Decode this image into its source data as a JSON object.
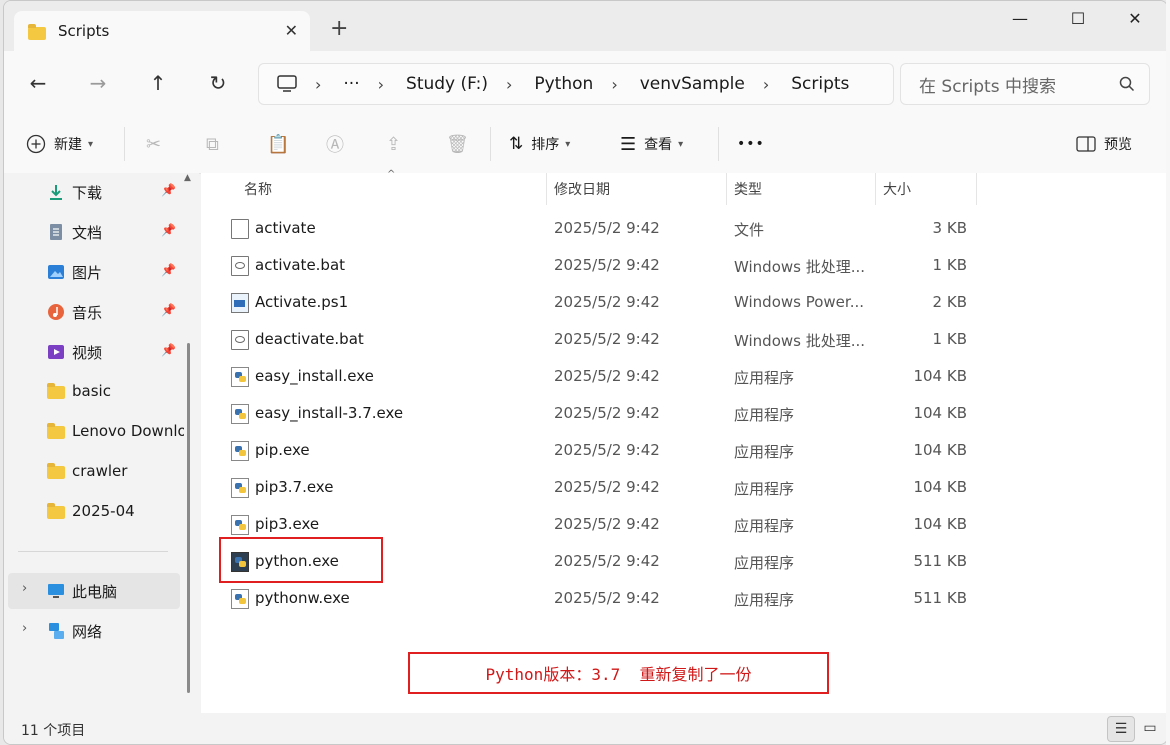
{
  "tab": {
    "title": "Scripts",
    "close": "✕",
    "new": "+"
  },
  "window_controls": {
    "minimize": "—",
    "maximize": "☐",
    "close": "✕"
  },
  "nav": {
    "back": "←",
    "forward": "→",
    "up": "↑",
    "refresh": "↻",
    "breadcrumb": [
      "Study (F:)",
      "Python",
      "venvSample",
      "Scripts"
    ],
    "overflow": "···",
    "separator": "›"
  },
  "search": {
    "placeholder": "在 Scripts 中搜索"
  },
  "toolbar": {
    "new_label": "新建",
    "sort_label": "排序",
    "view_label": "查看",
    "more_label": "•••",
    "preview_label": "预览"
  },
  "sidebar": {
    "quick_access": [
      {
        "label": "下载",
        "icon": "download-icon",
        "pinned": true
      },
      {
        "label": "文档",
        "icon": "document-icon",
        "pinned": true
      },
      {
        "label": "图片",
        "icon": "picture-icon",
        "pinned": true
      },
      {
        "label": "音乐",
        "icon": "music-icon",
        "pinned": true
      },
      {
        "label": "视频",
        "icon": "video-icon",
        "pinned": true
      },
      {
        "label": "basic",
        "icon": "folder-icon",
        "pinned": false
      },
      {
        "label": "Lenovo Downloads",
        "icon": "folder-icon",
        "pinned": false
      },
      {
        "label": "crawler",
        "icon": "folder-icon",
        "pinned": false
      },
      {
        "label": "2025-04",
        "icon": "folder-icon",
        "pinned": false
      }
    ],
    "this_pc": "此电脑",
    "network": "网络"
  },
  "columns": {
    "name": "名称",
    "date": "修改日期",
    "type": "类型",
    "size": "大小"
  },
  "files": [
    {
      "name": "activate",
      "date": "2025/5/2 9:42",
      "type": "文件",
      "size": "3 KB",
      "icon": "file-icon"
    },
    {
      "name": "activate.bat",
      "date": "2025/5/2 9:42",
      "type": "Windows 批处理...",
      "size": "1 KB",
      "icon": "batch-file-icon"
    },
    {
      "name": "Activate.ps1",
      "date": "2025/5/2 9:42",
      "type": "Windows Power...",
      "size": "2 KB",
      "icon": "powershell-file-icon"
    },
    {
      "name": "deactivate.bat",
      "date": "2025/5/2 9:42",
      "type": "Windows 批处理...",
      "size": "1 KB",
      "icon": "batch-file-icon"
    },
    {
      "name": "easy_install.exe",
      "date": "2025/5/2 9:42",
      "type": "应用程序",
      "size": "104 KB",
      "icon": "python-exe-icon"
    },
    {
      "name": "easy_install-3.7.exe",
      "date": "2025/5/2 9:42",
      "type": "应用程序",
      "size": "104 KB",
      "icon": "python-exe-icon"
    },
    {
      "name": "pip.exe",
      "date": "2025/5/2 9:42",
      "type": "应用程序",
      "size": "104 KB",
      "icon": "python-exe-icon"
    },
    {
      "name": "pip3.7.exe",
      "date": "2025/5/2 9:42",
      "type": "应用程序",
      "size": "104 KB",
      "icon": "python-exe-icon"
    },
    {
      "name": "pip3.exe",
      "date": "2025/5/2 9:42",
      "type": "应用程序",
      "size": "104 KB",
      "icon": "python-exe-icon"
    },
    {
      "name": "python.exe",
      "date": "2025/5/2 9:42",
      "type": "应用程序",
      "size": "511 KB",
      "icon": "python-console-icon"
    },
    {
      "name": "pythonw.exe",
      "date": "2025/5/2 9:42",
      "type": "应用程序",
      "size": "511 KB",
      "icon": "python-window-icon"
    }
  ],
  "annotation": {
    "text": "Python版本：3.7  重新复制了一份",
    "color": "#e02020"
  },
  "status": {
    "item_count": "11 个项目"
  }
}
